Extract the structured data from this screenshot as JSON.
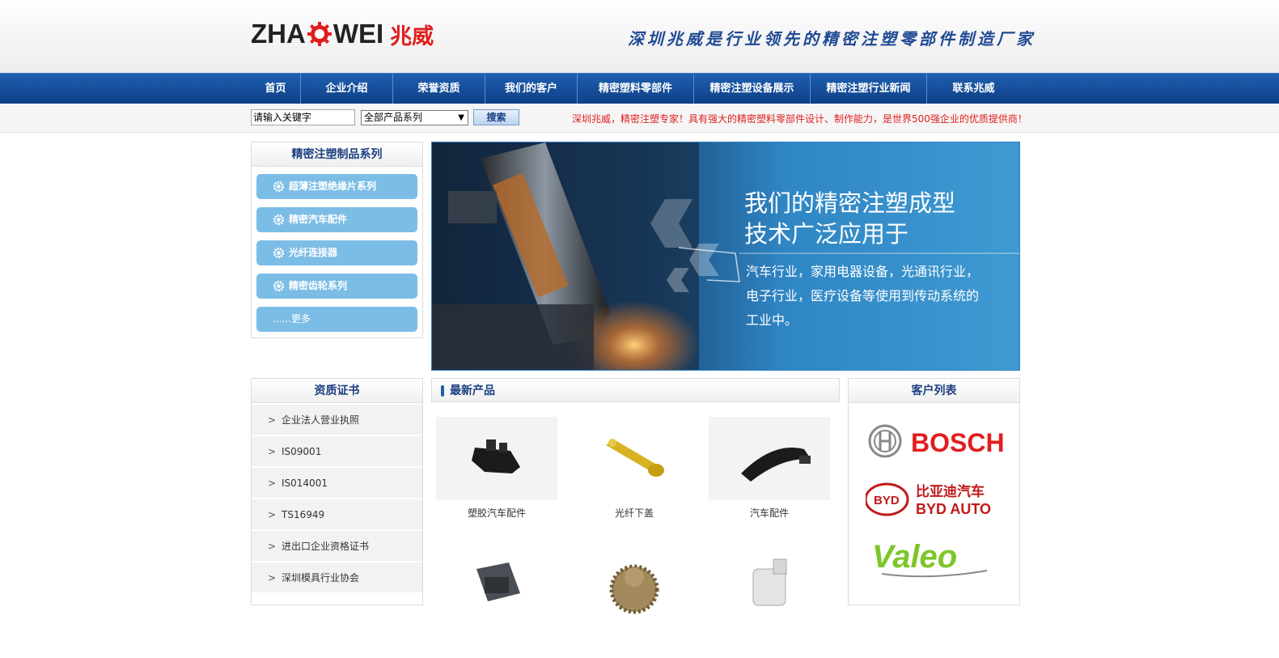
{
  "header": {
    "logo_text_left": "ZHA",
    "logo_text_right": "WEI",
    "logo_cn": "兆威",
    "slogan": "深圳兆威是行业领先的精密注塑零部件制造厂家"
  },
  "nav": {
    "items": [
      {
        "label": "首页"
      },
      {
        "label": "企业介绍"
      },
      {
        "label": "荣誉资质"
      },
      {
        "label": "我们的客户"
      },
      {
        "label": "精密塑料零部件"
      },
      {
        "label": "精密注塑设备展示"
      },
      {
        "label": "精密注塑行业新闻"
      },
      {
        "label": "联系兆威"
      }
    ]
  },
  "search": {
    "input_value": "请输入关键字",
    "select_value": "全部产品系列",
    "button_label": "搜索",
    "notice": "深圳兆威，精密注塑专家！具有强大的精密塑料零部件设计、制作能力，是世界500强企业的优质提供商！"
  },
  "categories": {
    "title": "精密注塑制品系列",
    "items": [
      {
        "label": "超薄注塑绝缘片系列"
      },
      {
        "label": "精密汽车配件"
      },
      {
        "label": "光纤连接器"
      },
      {
        "label": "精密齿轮系列"
      }
    ],
    "more_label": "......更多"
  },
  "banner": {
    "heading_line1": "我们的精密注塑成型",
    "heading_line2": "技术广泛应用于",
    "body_line1": "汽车行业，家用电器设备，光通讯行业，",
    "body_line2": "电子行业，医疗设备等使用到传动系统的",
    "body_line3": "工业中。"
  },
  "certs": {
    "title": "资质证书",
    "items": [
      {
        "label": "企业法人营业执照"
      },
      {
        "label": "IS09001"
      },
      {
        "label": "IS014001"
      },
      {
        "label": "TS16949"
      },
      {
        "label": "进出口企业资格证书"
      },
      {
        "label": "深圳模具行业协会"
      }
    ]
  },
  "products": {
    "title": "最新产品",
    "items": [
      {
        "caption": "塑胶汽车配件",
        "icon": "black-plastic-clip"
      },
      {
        "caption": "光纤下盖",
        "icon": "yellow-fiber-cap"
      },
      {
        "caption": "汽车配件",
        "icon": "black-car-part"
      },
      {
        "caption": "",
        "icon": "grey-connector"
      },
      {
        "caption": "",
        "icon": "brass-gear"
      },
      {
        "caption": "",
        "icon": "white-gear-part"
      }
    ]
  },
  "clients": {
    "title": "客户列表",
    "items": [
      {
        "name": "BOSCH"
      },
      {
        "name_cn": "比亚迪汽车",
        "name_en": "BYD AUTO",
        "badge": "BYD"
      },
      {
        "name": "Valeo"
      }
    ]
  },
  "colors": {
    "brand_blue": "#1f5fb0",
    "brand_red": "#e11e1e",
    "category_blue": "#7cbde6"
  }
}
